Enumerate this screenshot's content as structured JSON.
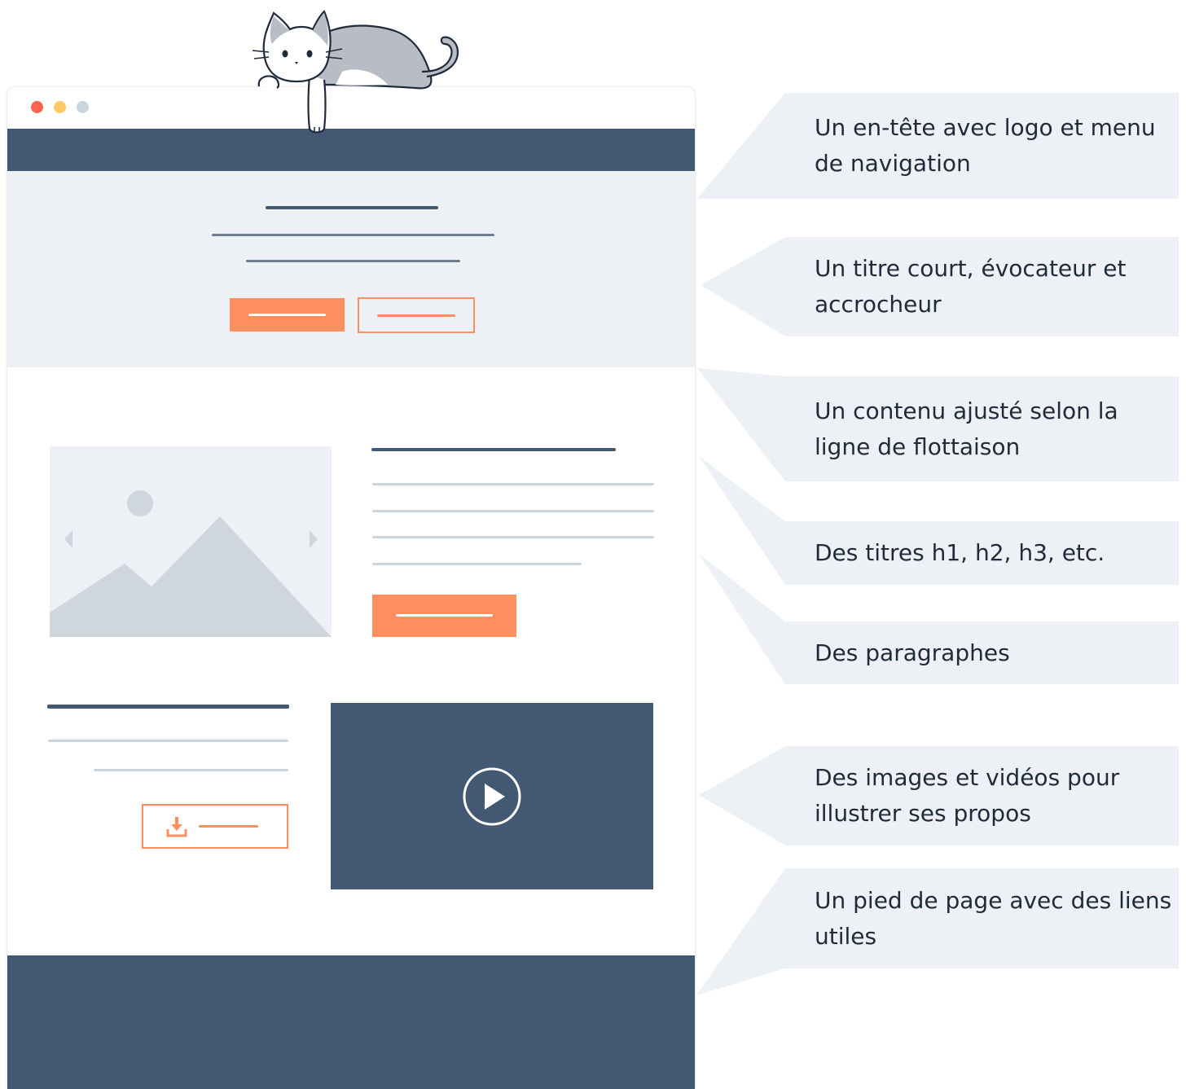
{
  "colors": {
    "navy": "#435873",
    "accent": "#ff8f5e",
    "light_bg": "#edf0f4",
    "callout_bg": "#edf1f6",
    "window_dots": [
      "#fe6450",
      "#fdca67",
      "#cbd5e0"
    ]
  },
  "icons": {
    "mascot": "cat-icon",
    "hero_image": "image-placeholder-icon",
    "carousel_prev": "chevron-left-icon",
    "carousel_next": "chevron-right-icon",
    "download": "download-icon",
    "video": "play-icon"
  },
  "callouts": [
    {
      "text": "Un en-tête avec logo et menu de navigation"
    },
    {
      "text": "Un titre court, évocateur et accrocheur"
    },
    {
      "text": "Un contenu ajusté selon la ligne de flottaison"
    },
    {
      "text": "Des titres h1, h2, h3, etc."
    },
    {
      "text": "Des paragraphes"
    },
    {
      "text": "Des images et vidéos pour illustrer ses propos"
    },
    {
      "text": "Un pied de page avec des liens utiles"
    }
  ]
}
